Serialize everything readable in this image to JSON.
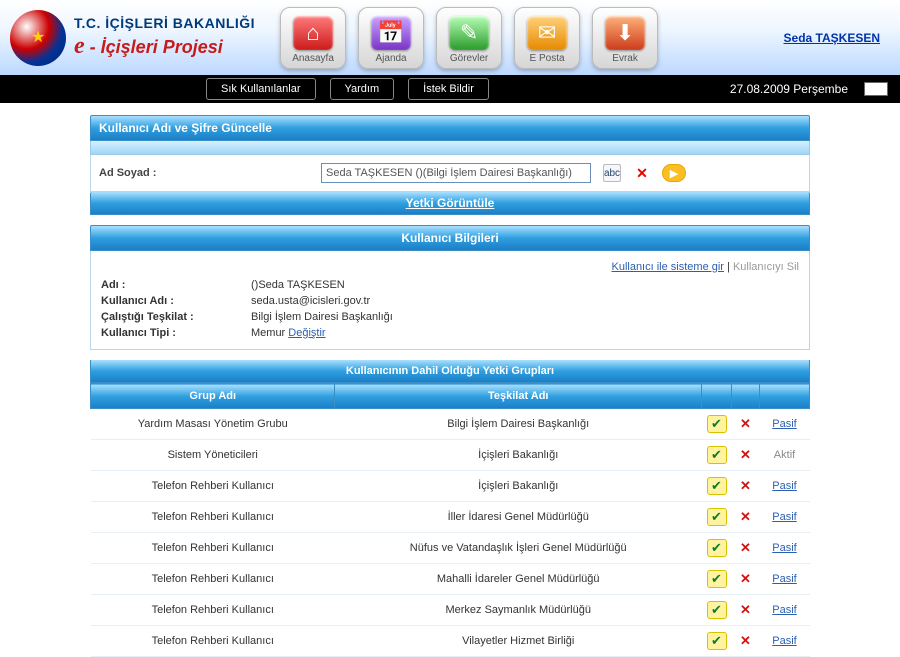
{
  "brand": {
    "line1": "T.C. İÇİŞLERİ BAKANLIĞI",
    "line2_prefix": "e",
    "line2_rest": " - İçişleri Projesi"
  },
  "nav": [
    {
      "id": "anasayfa",
      "label": "Anasayfa",
      "glyph": "⌂",
      "cls": "g-red"
    },
    {
      "id": "ajanda",
      "label": "Ajanda",
      "glyph": "📅",
      "cls": "g-purple"
    },
    {
      "id": "gorevler",
      "label": "Görevler",
      "glyph": "✎",
      "cls": "g-green"
    },
    {
      "id": "eposta",
      "label": "E Posta",
      "glyph": "✉",
      "cls": "g-orange"
    },
    {
      "id": "evrak",
      "label": "Evrak",
      "glyph": "⬇",
      "cls": "g-red2"
    }
  ],
  "user_link": "Seda TAŞKESEN",
  "black_bar": {
    "buttons": [
      "Sık Kullanılanlar",
      "Yardım",
      "İstek Bildir"
    ],
    "date": "27.08.2009 Perşembe"
  },
  "panel": {
    "title": "Kullanıcı Adı ve Şifre Güncelle",
    "form": {
      "ad_soyad_label": "Ad Soyad :",
      "ad_soyad_value": "Seda TAŞKESEN ()(Bilgi İşlem Dairesi Başkanlığı)"
    },
    "yetki_goruntule": "Yetki Görüntüle",
    "user_info_title": "Kullanıcı Bilgileri",
    "action_links": {
      "enter_as": "Kullanıcı ile sisteme gir",
      "sep": " | ",
      "delete": "Kullanıcıyı Sil"
    },
    "kv": {
      "adi_label": "Adı :",
      "adi_value": "()Seda TAŞKESEN",
      "kul_label": "Kullanıcı Adı :",
      "kul_value": "seda.usta@icisleri.gov.tr",
      "tesk_label": "Çalıştığı Teşkilat :",
      "tesk_value": "Bilgi İşlem Dairesi Başkanlığı",
      "tip_label": "Kullanıcı Tipi :",
      "tip_value": "Memur",
      "tip_change": "Değiştir"
    },
    "groups_title": "Kullanıcının Dahil Olduğu Yetki Grupları",
    "columns": {
      "grup": "Grup Adı",
      "teskilat": "Teşkilat Adı"
    },
    "status_labels": {
      "pasif": "Pasif",
      "aktif": "Aktif"
    },
    "rows": [
      {
        "grup": "Yardım Masası Yönetim Grubu",
        "teskilat": "Bilgi İşlem Dairesi Başkanlığı",
        "status": "pasif"
      },
      {
        "grup": "Sistem Yöneticileri",
        "teskilat": "İçişleri Bakanlığı",
        "status": "aktif"
      },
      {
        "grup": "Telefon Rehberi Kullanıcı",
        "teskilat": "İçişleri Bakanlığı",
        "status": "pasif"
      },
      {
        "grup": "Telefon Rehberi Kullanıcı",
        "teskilat": "İller İdaresi Genel Müdürlüğü",
        "status": "pasif"
      },
      {
        "grup": "Telefon Rehberi Kullanıcı",
        "teskilat": "Nüfus ve Vatandaşlık İşleri Genel Müdürlüğü",
        "status": "pasif"
      },
      {
        "grup": "Telefon Rehberi Kullanıcı",
        "teskilat": "Mahalli İdareler Genel Müdürlüğü",
        "status": "pasif"
      },
      {
        "grup": "Telefon Rehberi Kullanıcı",
        "teskilat": "Merkez Saymanlık Müdürlüğü",
        "status": "pasif"
      },
      {
        "grup": "Telefon Rehberi Kullanıcı",
        "teskilat": "Vilayetler Hizmet Birliği",
        "status": "pasif"
      }
    ]
  }
}
